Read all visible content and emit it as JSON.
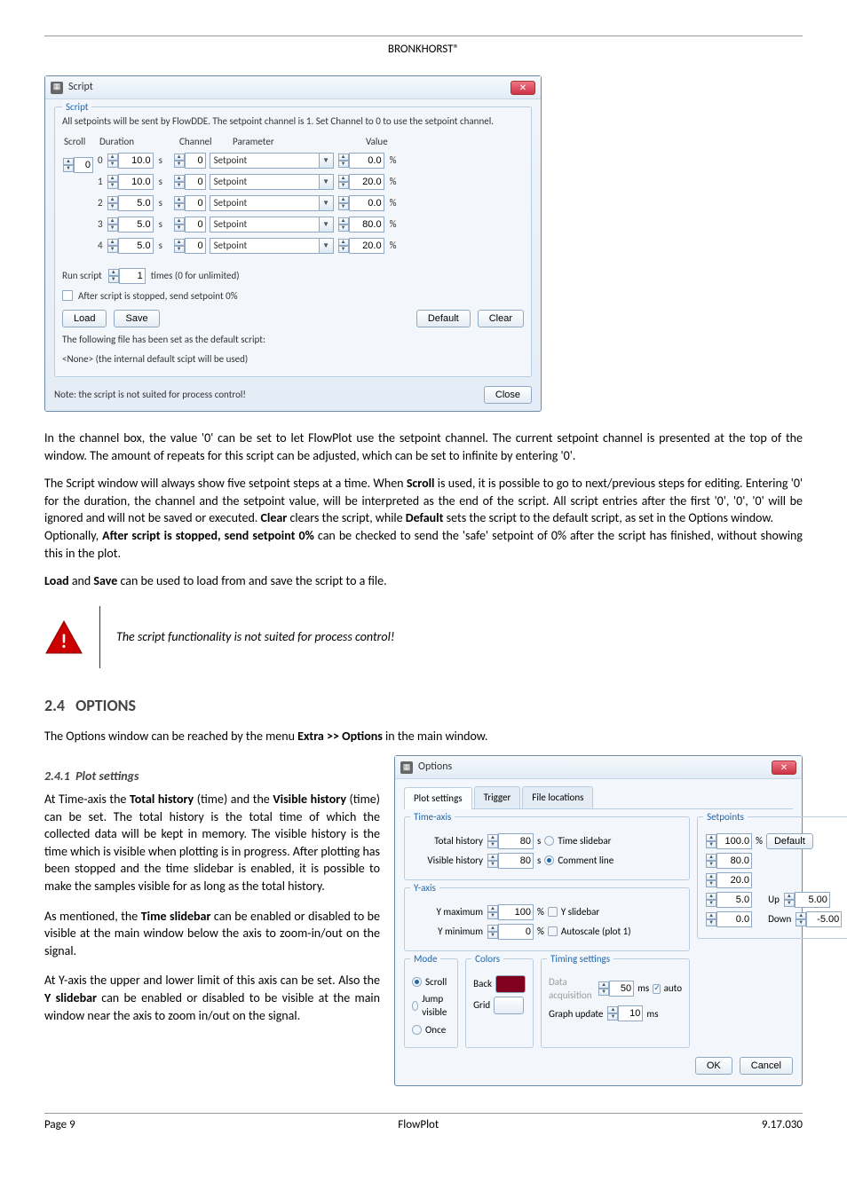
{
  "header": {
    "brand": "BRONKHORST®"
  },
  "script_window": {
    "title": "Script",
    "legend": "Script",
    "description": "All setpoints will be sent by FlowDDE. The setpoint channel is 1. Set Channel to 0 to use the setpoint channel.",
    "columns": {
      "scroll": "Scroll",
      "duration": "Duration",
      "channel": "Channel",
      "parameter": "Parameter",
      "value": "Value"
    },
    "scroll_value": "0",
    "rows": [
      {
        "idx": "0",
        "duration": "10.0",
        "dur_unit": "s",
        "channel": "0",
        "parameter": "Setpoint",
        "value": "0.0",
        "val_unit": "%"
      },
      {
        "idx": "1",
        "duration": "10.0",
        "dur_unit": "s",
        "channel": "0",
        "parameter": "Setpoint",
        "value": "20.0",
        "val_unit": "%"
      },
      {
        "idx": "2",
        "duration": "5.0",
        "dur_unit": "s",
        "channel": "0",
        "parameter": "Setpoint",
        "value": "0.0",
        "val_unit": "%"
      },
      {
        "idx": "3",
        "duration": "5.0",
        "dur_unit": "s",
        "channel": "0",
        "parameter": "Setpoint",
        "value": "80.0",
        "val_unit": "%"
      },
      {
        "idx": "4",
        "duration": "5.0",
        "dur_unit": "s",
        "channel": "0",
        "parameter": "Setpoint",
        "value": "20.0",
        "val_unit": "%"
      }
    ],
    "run_label_left": "Run script",
    "run_times": "1",
    "run_label_right": "times (0 for unlimited)",
    "after_stop_label": "After script is stopped, send setpoint 0%",
    "load": "Load",
    "save": "Save",
    "default": "Default",
    "clear": "Clear",
    "file_note1": "The following file has been set as the default script:",
    "file_note2": "<None> (the internal default scipt will be used)",
    "note": "Note: the script is not suited for process control!",
    "close": "Close"
  },
  "body": {
    "p1a": "In the channel box, the value '0' can be set to let FlowPlot use the setpoint channel. The current setpoint channel is presented at the top of the window. The amount of repeats for this script can be adjusted, which can be set to infinite by entering '0'.",
    "p2a": "The Script window will always show five setpoint steps at a time. When ",
    "p2b": "Scroll",
    "p2c": " is used, it is possible to go to next/previous steps for editing. Entering '0' for the duration, the channel and the setpoint value, will be interpreted as the end of the script. All script entries after the first '0', '0', '0' will be ignored and will not be saved or executed. ",
    "p2d": "Clear",
    "p2e": " clears the script, while ",
    "p2f": "Default",
    "p2g": " sets the script to the default script, as set in the Options window.",
    "p3a": "Optionally, ",
    "p3b": "After script is stopped, send setpoint 0%",
    "p3c": " can be checked to send the 'safe' setpoint of 0% after the script has finished, without showing this in the plot.",
    "p4a": "Load",
    "p4b": " and ",
    "p4c": "Save",
    "p4d": " can be used to load from and save the script to a file.",
    "warning": "The script functionality is not suited for process control!",
    "sec_num": "2.4",
    "sec_title": "OPTIONS",
    "p5a": "The Options window can be reached by the menu ",
    "p5b": "Extra >> Options",
    "p5c": " in the main window.",
    "sub_num": "2.4.1",
    "sub_title": "Plot settings",
    "p6a": "At Time-axis the ",
    "p6b": "Total history",
    "p6c": " (time) and the ",
    "p6d": "Visible history",
    "p6e": " (time) can be set. The total history is the total time of which the collected data will be kept in memory. The visible history is the time which is visible when plotting is in progress. After plotting has been stopped and the time slidebar is enabled, it is possible to make the samples visible for as long as the total history.",
    "p7a": "As mentioned, the ",
    "p7b": "Time slidebar",
    "p7c": " can be enabled or disabled to be visible at the main window below the axis to zoom-in/out on the signal.",
    "p8a": "At Y-axis the upper and lower limit of this axis can be set. Also the ",
    "p8b": "Y slidebar",
    "p8c": " can be enabled or disabled to be visible at the main window near the axis to zoom in/out on the signal."
  },
  "options_window": {
    "title": "Options",
    "tabs": {
      "plot": "Plot settings",
      "trigger": "Trigger",
      "file": "File locations"
    },
    "time_axis": {
      "legend": "Time-axis",
      "total_history_label": "Total history",
      "total_history_value": "80",
      "total_history_unit": "s",
      "visible_history_label": "Visible history",
      "visible_history_value": "80",
      "visible_history_unit": "s",
      "time_slidebar": "Time slidebar",
      "comment_line": "Comment line"
    },
    "y_axis": {
      "legend": "Y-axis",
      "ymax_label": "Y maximum",
      "ymax_value": "100",
      "ymax_unit": "%",
      "ymin_label": "Y minimum",
      "ymin_value": "0",
      "ymin_unit": "%",
      "y_slidebar": "Y slidebar",
      "autoscale": "Autoscale (plot 1)"
    },
    "mode": {
      "legend": "Mode",
      "scroll": "Scroll",
      "jump": "Jump visible",
      "once": "Once"
    },
    "colors": {
      "legend": "Colors",
      "back": "Back",
      "grid": "Grid"
    },
    "setpoints": {
      "legend": "Setpoints",
      "values": [
        "100.0",
        "80.0",
        "20.0",
        "5.0",
        "0.0"
      ],
      "default": "Default",
      "up": "Up",
      "up_val": "5.00",
      "down": "Down",
      "down_val": "-5.00",
      "unit": "%"
    },
    "timing": {
      "legend": "Timing settings",
      "data_acq_label": "Data acquisition",
      "data_acq_value": "50",
      "data_acq_unit": "ms",
      "auto": "auto",
      "graph_upd_label": "Graph update",
      "graph_upd_value": "10",
      "graph_upd_unit": "ms"
    },
    "ok": "OK",
    "cancel": "Cancel"
  },
  "footer": {
    "left": "Page 9",
    "center": "FlowPlot",
    "right": "9.17.030"
  }
}
